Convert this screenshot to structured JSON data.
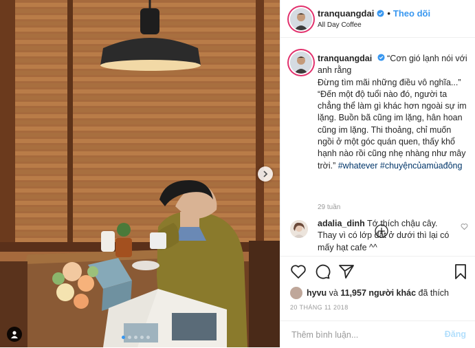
{
  "post": {
    "username": "tranquangdai",
    "separator": "•",
    "follow_label": "Theo dõi",
    "location": "All Day Coffee"
  },
  "caption": {
    "username": "tranquangdai",
    "line1": "“Cơn gió lạnh nói với anh rằng",
    "line2": "Đừng tìm mãi những điều vô nghĩa...”",
    "line3": "“Đến một độ tuổi nào đó, người ta chẳng thể làm gì khác hơn ngoài sự im lặng. Buồn bã cũng im lặng, hân hoan cũng im lặng. Thi thoảng, chỉ muốn ngồi ở một góc quán quen, thấy khổ hạnh nào rồi cũng nhẹ nhàng như mây trời.”",
    "hashtag1": "#whatever",
    "hashtag2": "#chuyệncủamùađông",
    "age": "29 tuần"
  },
  "comment": {
    "username": "adalia_dinh",
    "text": "Tớ thích chậu cây. Thay vì có lớp đất ở dưới thì lại có mấy hạt cafe ^^"
  },
  "likes": {
    "user": "hyvu",
    "connector": "và",
    "count_text": "11,957 người khác",
    "suffix": "đã thích"
  },
  "date": "20 THÁNG 11 2018",
  "add_comment": {
    "placeholder": "Thêm bình luận...",
    "post_label": "Đăng"
  },
  "icons": {
    "verified": "verified-badge-icon",
    "more": "plus-circle-icon",
    "like": "heart-icon",
    "comment": "comment-icon",
    "share": "share-icon",
    "save": "bookmark-icon",
    "next": "chevron-right-icon",
    "tag": "user-tag-icon"
  },
  "colors": {
    "accent": "#3897f0",
    "link": "#003569",
    "muted": "#999999",
    "disabled_post": "#b2dffc"
  },
  "carousel": {
    "count": 5,
    "active": 1
  }
}
